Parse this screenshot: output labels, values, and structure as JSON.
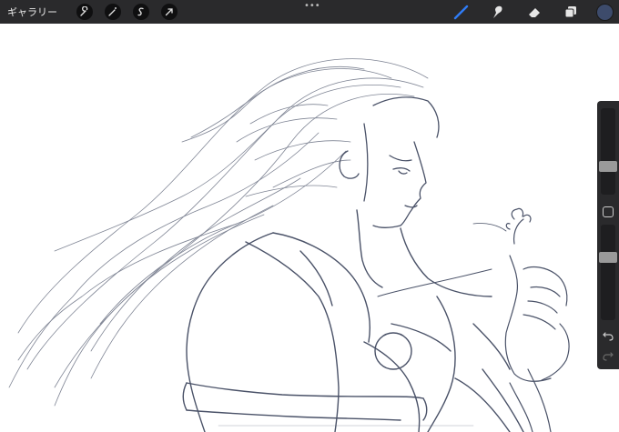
{
  "toolbar": {
    "gallery_label": "ギャラリー",
    "left_tools": [
      "wrench-icon",
      "magic-wand-icon",
      "selection-icon",
      "transform-arrow-icon"
    ],
    "more_label": "•••",
    "right_tools": [
      "brush-icon",
      "smudge-icon",
      "eraser-icon",
      "layers-icon"
    ],
    "active_color": "#3d4b6b",
    "brush_active_color": "#2f7cf6"
  },
  "sidebar": {
    "brush_size_level": 0.3,
    "opacity_level": 0.35
  },
  "canvas": {
    "stroke_color": "#4a5268"
  }
}
